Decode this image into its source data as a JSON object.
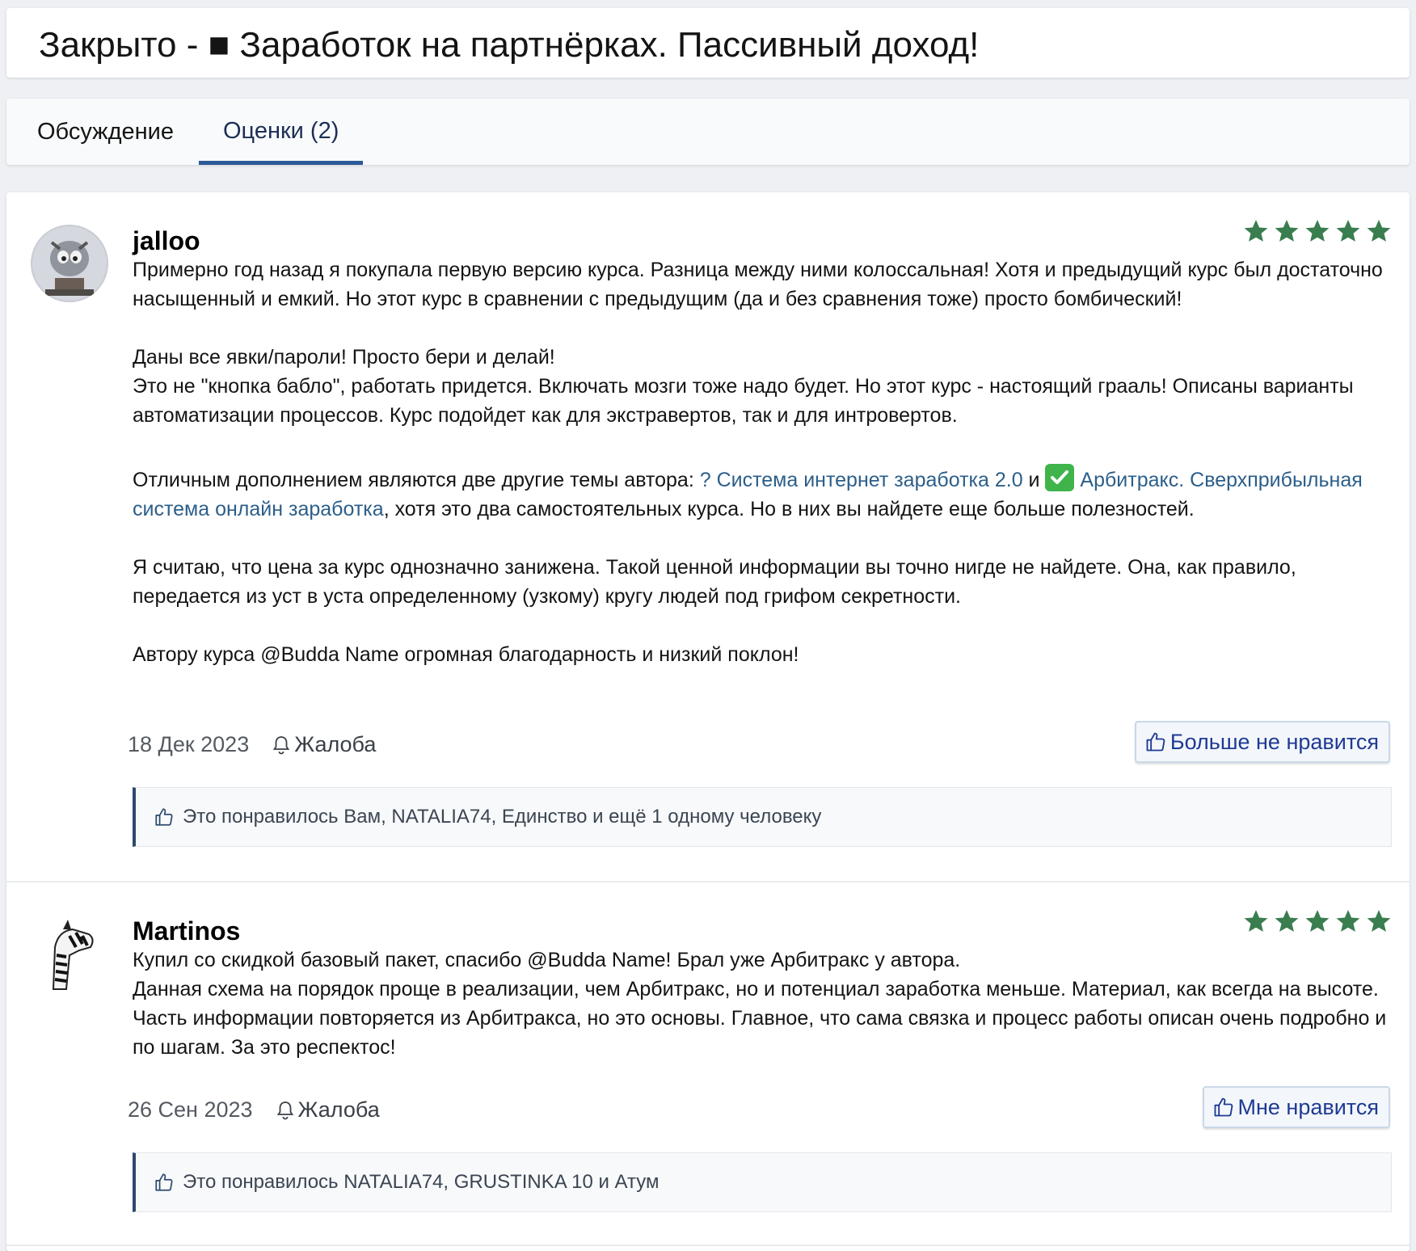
{
  "page_title": "Закрыто - ■ Заработок на партнёрках. Пассивный доход!",
  "tabs": [
    {
      "label": "Обсуждение",
      "active": false
    },
    {
      "label": "Оценки (2)",
      "active": true
    }
  ],
  "colors": {
    "star": "#3a7d4f",
    "link": "#2c5f8a",
    "tab_active_underline": "#2b5a96"
  },
  "reviews": [
    {
      "username": "jalloo",
      "rating": 5,
      "paragraphs": {
        "p1": "Примерно год назад я покупала первую версию курса. Разница между ними колоссальная! Хотя и предыдущий курс был достаточно насыщенный и емкий. Но этот курс в сравнении с предыдущим (да и без сравнения тоже) просто бомбический!",
        "p2": "Даны все явки/пароли! Просто бери и делай!",
        "p3": "Это не \"кнопка бабло\", работать придется. Включать мозги тоже надо будет. Но этот курс - настоящий грааль! Описаны варианты автоматизации процессов. Курс подойдет как для экстравертов, так и для интровертов.",
        "p4_start": "Отличным дополнением являются две другие темы автора: ",
        "p4_link1": "? Система интернет заработка 2.0",
        "p4_mid": " и ",
        "p4_link2": " Арбитракс. Сверхприбыльная система онлайн заработка",
        "p4_end": ", хотя это два самостоятельных курса. Но в них вы найдете еще больше полезностей.",
        "p5": "Я считаю, что цена за курс однозначно занижена. Такой ценной информации вы точно нигде не найдете. Она, как правило, передается из уст в уста определенному (узкому) кругу людей под грифом секретности.",
        "p6": "Автору курса @Budda Name огромная благодарность и низкий поклон!"
      },
      "date": "18 Дек 2023",
      "report_label": "Жалоба",
      "like_button_label": "Больше не нравится",
      "likes_text": "Это понравилось Вам, NATALIA74, Единство и ещё 1 одному человеку"
    },
    {
      "username": "Martinos",
      "rating": 5,
      "paragraphs": {
        "p1": "Купил со скидкой базовый пакет, спасибо @Budda Name! Брал уже Арбитракс у автора.",
        "p2": "Данная схема на порядок проще в реализации, чем Арбитракс, но и потенциал заработка меньше. Материал, как всегда на высоте. Часть информации повторяется из Арбитракса, но это основы. Главное, что сама связка и процесс работы описан очень подробно и по шагам. За это респектос!"
      },
      "date": "26 Сен 2023",
      "report_label": "Жалоба",
      "like_button_label": "Мне нравится",
      "likes_text": "Это понравилось NATALIA74, GRUSTINKA 10 и Атум"
    }
  ]
}
